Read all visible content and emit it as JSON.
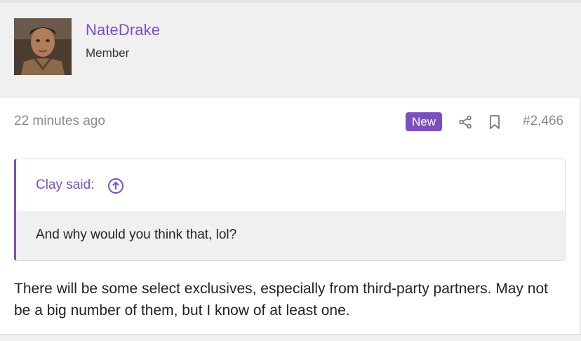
{
  "user": {
    "name": "NateDrake",
    "title": "Member",
    "avatar_icon": "user-avatar-photo"
  },
  "post": {
    "timestamp": "22 minutes ago",
    "badge": "New",
    "number": "#2,466",
    "text": "There will be some select exclusives, especially from third-party partners. May not be a big number of them, but I know of at least one."
  },
  "quote": {
    "author": "Clay said:",
    "text": "And why would you think that, lol?"
  },
  "icons": {
    "share": "share-icon",
    "bookmark": "bookmark-icon",
    "quote_jump": "arrow-up-circle-icon"
  },
  "colors": {
    "accent": "#7c4fbf",
    "panel": "#f0f0f1",
    "muted": "#8a8a8a"
  }
}
